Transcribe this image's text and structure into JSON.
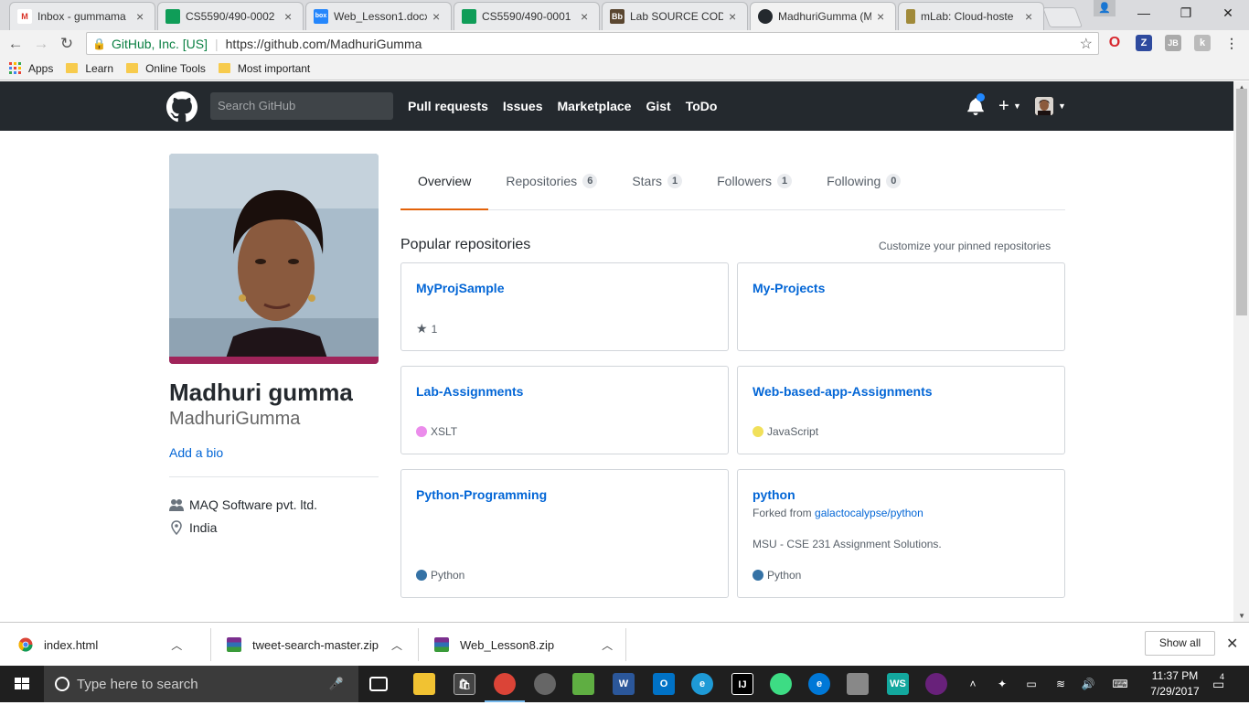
{
  "browser": {
    "tabs": [
      {
        "title": "Inbox - gummama",
        "icon": "gmail-icon",
        "color": "#d93025",
        "letter": "M"
      },
      {
        "title": "CS5590/490-0002",
        "icon": "sheets-icon",
        "color": "#0f9d58",
        "letter": ""
      },
      {
        "title": "Web_Lesson1.docx",
        "icon": "box-icon",
        "color": "#2486fc",
        "letter": "box"
      },
      {
        "title": "CS5590/490-0001",
        "icon": "sheets-icon",
        "color": "#0f9d58",
        "letter": ""
      },
      {
        "title": "Lab SOURCE CODE",
        "icon": "blackboard-icon",
        "color": "#5a4630",
        "letter": "Bb"
      },
      {
        "title": "MadhuriGumma (M",
        "icon": "github-icon",
        "color": "#24292e",
        "letter": ""
      },
      {
        "title": "mLab: Cloud-hoste",
        "icon": "mlab-icon",
        "color": "#a08a3a",
        "letter": ""
      }
    ],
    "window_controls": [
      "—",
      "❐",
      "✕"
    ],
    "secure_label": "GitHub, Inc. [US]",
    "url": "https://github.com/MadhuriGumma",
    "bookmarks": {
      "apps": "Apps",
      "items": [
        "Learn",
        "Online Tools",
        "Most important"
      ]
    }
  },
  "github": {
    "search_placeholder": "Search GitHub",
    "nav": [
      "Pull requests",
      "Issues",
      "Marketplace",
      "Gist",
      "ToDo"
    ],
    "plus": "+"
  },
  "profile": {
    "fullname": "Madhuri gumma",
    "username": "MadhuriGumma",
    "add_bio": "Add a bio",
    "company": "MAQ Software pvt. ltd.",
    "location": "India"
  },
  "tabs": [
    {
      "label": "Overview",
      "count": ""
    },
    {
      "label": "Repositories",
      "count": "6"
    },
    {
      "label": "Stars",
      "count": "1"
    },
    {
      "label": "Followers",
      "count": "1"
    },
    {
      "label": "Following",
      "count": "0"
    }
  ],
  "popular": {
    "title": "Popular repositories",
    "customize": "Customize your pinned repositories",
    "repos": [
      {
        "name": "MyProjSample",
        "meta": "1",
        "meta_kind": "star"
      },
      {
        "name": "My-Projects"
      },
      {
        "name": "Lab-Assignments",
        "meta": "XSLT",
        "meta_kind": "lang",
        "lang_color": "#EB8CEB"
      },
      {
        "name": "Web-based-app-Assignments",
        "meta": "JavaScript",
        "meta_kind": "lang",
        "lang_color": "#f1e05a"
      },
      {
        "name": "Python-Programming",
        "meta": "Python",
        "meta_kind": "lang",
        "lang_color": "#3572A5"
      },
      {
        "name": "python",
        "forked_prefix": "Forked from ",
        "forked_from": "galactocalypse/python",
        "desc": "MSU - CSE 231 Assignment Solutions.",
        "meta": "Python",
        "meta_kind": "lang",
        "lang_color": "#3572A5"
      }
    ]
  },
  "downloads": {
    "items": [
      "index.html",
      "tweet-search-master.zip",
      "Web_Lesson8.zip"
    ],
    "show_all": "Show all"
  },
  "taskbar": {
    "search_placeholder": "Type here to search",
    "time": "11:37 PM",
    "date": "7/29/2017",
    "notif_count": "4"
  }
}
